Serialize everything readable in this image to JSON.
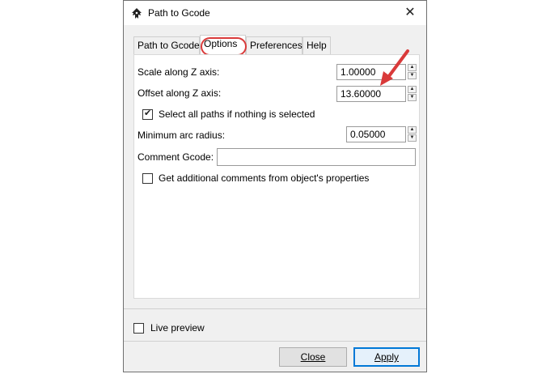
{
  "window": {
    "title": "Path to Gcode",
    "close_label": "✕"
  },
  "tabs": [
    {
      "label": "Path to Gcode",
      "active": false
    },
    {
      "label": "Options",
      "active": true
    },
    {
      "label": "Preferences",
      "active": false
    },
    {
      "label": "Help",
      "active": false
    }
  ],
  "options": {
    "scale_label": "Scale along Z axis:",
    "scale_value": "1.00000",
    "offset_label": "Offset along Z axis:",
    "offset_value": "13.60000",
    "select_all_label": "Select all paths if nothing is selected",
    "select_all_checked": true,
    "min_arc_label": "Minimum arc radius:",
    "min_arc_value": "0.05000",
    "comment_label": "Comment Gcode:",
    "comment_value": "",
    "additional_label": "Get additional comments from object's properties",
    "additional_checked": false
  },
  "footer": {
    "live_preview_label": "Live preview",
    "live_preview_checked": false,
    "close_label": "Close",
    "apply_label": "Apply"
  },
  "colors": {
    "annotation": "#d93a3a",
    "accent": "#0078d7"
  },
  "icons": {
    "app": "inkscape-icon",
    "spin_up": "spin-up-icon",
    "spin_down": "spin-down-icon",
    "check": "checkmark-icon"
  }
}
